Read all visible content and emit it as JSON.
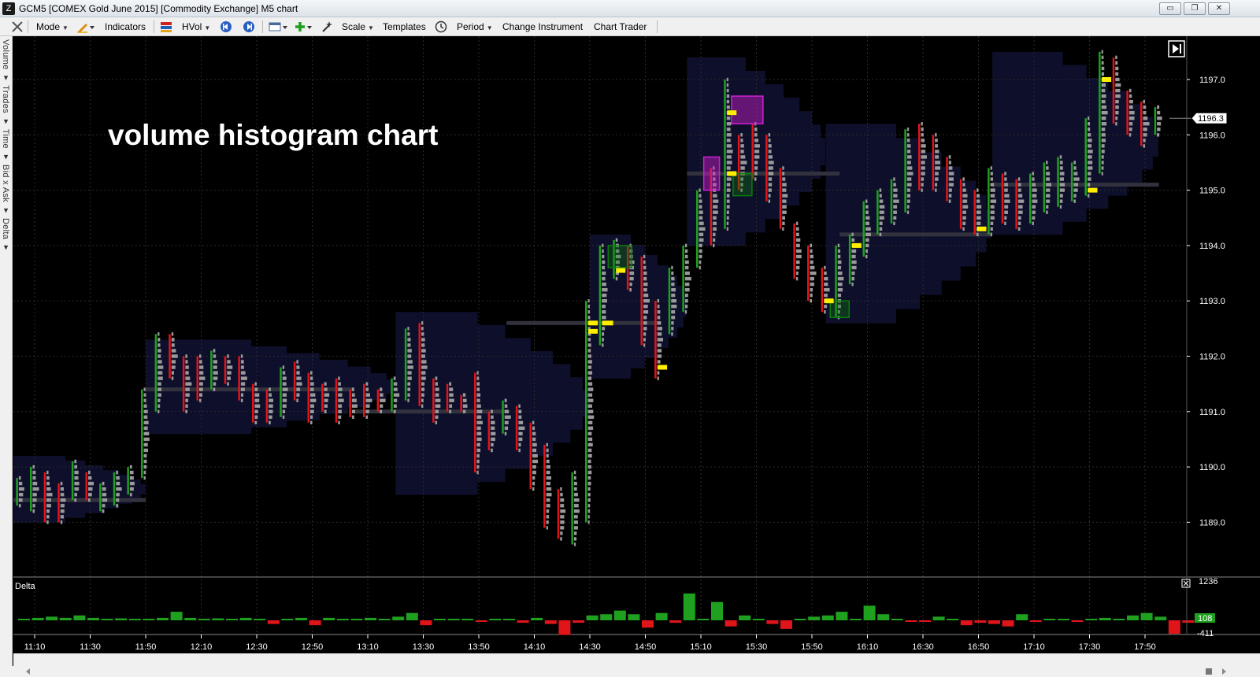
{
  "window": {
    "title": "GCM5 [COMEX Gold June 2015] [Commodity Exchange] M5 chart",
    "logo_letter": "Z",
    "minimize_symbol": "▭",
    "restore_symbol": "❐",
    "close_symbol": "✕"
  },
  "toolbar": {
    "items": [
      {
        "icon": "crosshair-tool-icon",
        "label": "",
        "arrow": false
      },
      {
        "icon": "",
        "label": "Mode",
        "arrow": true
      },
      {
        "icon": "pencil-draw-icon",
        "label": "",
        "arrow": true
      },
      {
        "icon": "",
        "label": "Indicators",
        "arrow": false
      },
      {
        "icon": "color-scheme-icon",
        "label": "",
        "arrow": false
      },
      {
        "icon": "",
        "label": "HVol",
        "arrow": true
      },
      {
        "icon": "rewind-icon",
        "label": "",
        "arrow": false
      },
      {
        "icon": "forward-icon",
        "label": "",
        "arrow": false
      },
      {
        "icon": "chart-window-icon",
        "label": "",
        "arrow": true
      },
      {
        "icon": "add-plus-icon",
        "label": "",
        "arrow": true
      },
      {
        "icon": "magic-wand-icon",
        "label": "",
        "arrow": false
      },
      {
        "icon": "",
        "label": "Scale",
        "arrow": true
      },
      {
        "icon": "",
        "label": "Templates",
        "arrow": false
      },
      {
        "icon": "clock-icon",
        "label": "",
        "arrow": false
      },
      {
        "icon": "",
        "label": "Period",
        "arrow": true
      },
      {
        "icon": "",
        "label": "Change Instrument",
        "arrow": false
      },
      {
        "icon": "",
        "label": "Chart Trader",
        "arrow": false
      }
    ]
  },
  "left_tabs": "Volume ▾ Trades ▾ Time ▾ Bid x Ask ▾ Delta ▾",
  "annotation": "volume histogram chart",
  "chart_data": {
    "type": "bar",
    "instrument": "GCM5",
    "period": "M5",
    "y_ticks": [
      "1197.0",
      "1196.0",
      "1195.0",
      "1194.0",
      "1193.0",
      "1192.0",
      "1191.0",
      "1190.0",
      "1189.0"
    ],
    "ylim": [
      1188.0,
      1197.8
    ],
    "last_price": "1196.3",
    "x_ticks": [
      "11:10",
      "11:30",
      "11:50",
      "12:10",
      "12:30",
      "12:50",
      "13:10",
      "13:30",
      "13:50",
      "14:10",
      "14:30",
      "14:50",
      "15:10",
      "15:30",
      "15:50",
      "16:10",
      "16:30",
      "16:50",
      "17:10",
      "17:30",
      "17:50"
    ],
    "bars": [
      {
        "t": "11:05",
        "low": 1189.3,
        "high": 1189.8,
        "dir": "up"
      },
      {
        "t": "11:10",
        "low": 1189.2,
        "high": 1190.0,
        "dir": "up"
      },
      {
        "t": "11:15",
        "low": 1189.0,
        "high": 1189.9,
        "dir": "down"
      },
      {
        "t": "11:20",
        "low": 1189.0,
        "high": 1189.7,
        "dir": "down"
      },
      {
        "t": "11:25",
        "low": 1189.4,
        "high": 1190.1,
        "dir": "up"
      },
      {
        "t": "11:30",
        "low": 1189.4,
        "high": 1189.9,
        "dir": "down"
      },
      {
        "t": "11:35",
        "low": 1189.2,
        "high": 1189.7,
        "dir": "up"
      },
      {
        "t": "11:40",
        "low": 1189.3,
        "high": 1189.9,
        "dir": "up"
      },
      {
        "t": "11:45",
        "low": 1189.5,
        "high": 1190.0,
        "dir": "up"
      },
      {
        "t": "11:50",
        "low": 1189.8,
        "high": 1191.4,
        "dir": "up"
      },
      {
        "t": "11:55",
        "low": 1191.0,
        "high": 1192.4,
        "dir": "up"
      },
      {
        "t": "12:00",
        "low": 1191.6,
        "high": 1192.4,
        "dir": "down"
      },
      {
        "t": "12:05",
        "low": 1191.0,
        "high": 1192.0,
        "dir": "down"
      },
      {
        "t": "12:10",
        "low": 1191.2,
        "high": 1192.0,
        "dir": "down"
      },
      {
        "t": "12:15",
        "low": 1191.4,
        "high": 1192.1,
        "dir": "up"
      },
      {
        "t": "12:20",
        "low": 1191.5,
        "high": 1192.0,
        "dir": "down"
      },
      {
        "t": "12:25",
        "low": 1191.2,
        "high": 1192.0,
        "dir": "down"
      },
      {
        "t": "12:30",
        "low": 1190.8,
        "high": 1191.5,
        "dir": "down"
      },
      {
        "t": "12:35",
        "low": 1190.8,
        "high": 1191.4,
        "dir": "down"
      },
      {
        "t": "12:40",
        "low": 1190.9,
        "high": 1191.8,
        "dir": "up"
      },
      {
        "t": "12:45",
        "low": 1191.2,
        "high": 1191.9,
        "dir": "down"
      },
      {
        "t": "12:50",
        "low": 1190.8,
        "high": 1191.7,
        "dir": "down"
      },
      {
        "t": "12:55",
        "low": 1191.0,
        "high": 1191.5,
        "dir": "down"
      },
      {
        "t": "13:00",
        "low": 1190.8,
        "high": 1191.6,
        "dir": "down"
      },
      {
        "t": "13:05",
        "low": 1190.9,
        "high": 1191.4,
        "dir": "down"
      },
      {
        "t": "13:10",
        "low": 1190.9,
        "high": 1191.5,
        "dir": "down"
      },
      {
        "t": "13:15",
        "low": 1191.0,
        "high": 1191.4,
        "dir": "down"
      },
      {
        "t": "13:20",
        "low": 1191.0,
        "high": 1191.6,
        "dir": "up"
      },
      {
        "t": "13:25",
        "low": 1191.2,
        "high": 1192.5,
        "dir": "up"
      },
      {
        "t": "13:30",
        "low": 1191.1,
        "high": 1192.6,
        "dir": "down"
      },
      {
        "t": "13:35",
        "low": 1190.8,
        "high": 1191.6,
        "dir": "down"
      },
      {
        "t": "13:40",
        "low": 1191.0,
        "high": 1191.5,
        "dir": "down"
      },
      {
        "t": "13:45",
        "low": 1191.0,
        "high": 1191.3,
        "dir": "down"
      },
      {
        "t": "13:50",
        "low": 1189.9,
        "high": 1191.7,
        "dir": "down"
      },
      {
        "t": "13:55",
        "low": 1190.3,
        "high": 1191.0,
        "dir": "down"
      },
      {
        "t": "14:00",
        "low": 1190.6,
        "high": 1191.2,
        "dir": "up"
      },
      {
        "t": "14:05",
        "low": 1190.3,
        "high": 1191.1,
        "dir": "down"
      },
      {
        "t": "14:10",
        "low": 1189.6,
        "high": 1190.8,
        "dir": "down"
      },
      {
        "t": "14:15",
        "low": 1188.9,
        "high": 1190.4,
        "dir": "down"
      },
      {
        "t": "14:20",
        "low": 1188.7,
        "high": 1189.6,
        "dir": "down"
      },
      {
        "t": "14:25",
        "low": 1188.6,
        "high": 1189.9,
        "dir": "up"
      },
      {
        "t": "14:30",
        "low": 1189.0,
        "high": 1193.0,
        "dir": "up"
      },
      {
        "t": "14:35",
        "low": 1192.2,
        "high": 1194.0,
        "dir": "up"
      },
      {
        "t": "14:40",
        "low": 1193.4,
        "high": 1194.1,
        "dir": "up"
      },
      {
        "t": "14:45",
        "low": 1193.2,
        "high": 1194.0,
        "dir": "down"
      },
      {
        "t": "14:50",
        "low": 1192.2,
        "high": 1193.8,
        "dir": "down"
      },
      {
        "t": "14:55",
        "low": 1191.6,
        "high": 1193.0,
        "dir": "down"
      },
      {
        "t": "15:00",
        "low": 1192.4,
        "high": 1193.6,
        "dir": "up"
      },
      {
        "t": "15:05",
        "low": 1192.8,
        "high": 1194.0,
        "dir": "up"
      },
      {
        "t": "15:10",
        "low": 1193.6,
        "high": 1195.0,
        "dir": "up"
      },
      {
        "t": "15:15",
        "low": 1194.0,
        "high": 1195.4,
        "dir": "down"
      },
      {
        "t": "15:20",
        "low": 1194.3,
        "high": 1197.0,
        "dir": "up"
      },
      {
        "t": "15:25",
        "low": 1195.0,
        "high": 1196.0,
        "dir": "down"
      },
      {
        "t": "15:30",
        "low": 1195.2,
        "high": 1196.2,
        "dir": "down"
      },
      {
        "t": "15:35",
        "low": 1194.8,
        "high": 1196.0,
        "dir": "down"
      },
      {
        "t": "15:40",
        "low": 1194.3,
        "high": 1195.4,
        "dir": "down"
      },
      {
        "t": "15:45",
        "low": 1193.4,
        "high": 1194.4,
        "dir": "down"
      },
      {
        "t": "15:50",
        "low": 1193.0,
        "high": 1194.0,
        "dir": "down"
      },
      {
        "t": "15:55",
        "low": 1192.8,
        "high": 1193.6,
        "dir": "down"
      },
      {
        "t": "16:00",
        "low": 1192.7,
        "high": 1194.0,
        "dir": "up"
      },
      {
        "t": "16:05",
        "low": 1193.3,
        "high": 1194.2,
        "dir": "up"
      },
      {
        "t": "16:10",
        "low": 1193.8,
        "high": 1194.8,
        "dir": "up"
      },
      {
        "t": "16:15",
        "low": 1194.2,
        "high": 1195.0,
        "dir": "up"
      },
      {
        "t": "16:20",
        "low": 1194.4,
        "high": 1195.2,
        "dir": "up"
      },
      {
        "t": "16:25",
        "low": 1194.6,
        "high": 1196.1,
        "dir": "up"
      },
      {
        "t": "16:30",
        "low": 1195.0,
        "high": 1196.2,
        "dir": "down"
      },
      {
        "t": "16:35",
        "low": 1195.0,
        "high": 1196.0,
        "dir": "down"
      },
      {
        "t": "16:40",
        "low": 1194.8,
        "high": 1195.6,
        "dir": "down"
      },
      {
        "t": "16:45",
        "low": 1194.3,
        "high": 1195.2,
        "dir": "down"
      },
      {
        "t": "16:50",
        "low": 1194.2,
        "high": 1195.0,
        "dir": "down"
      },
      {
        "t": "16:55",
        "low": 1194.2,
        "high": 1195.4,
        "dir": "up"
      },
      {
        "t": "17:00",
        "low": 1194.4,
        "high": 1195.3,
        "dir": "down"
      },
      {
        "t": "17:05",
        "low": 1194.3,
        "high": 1195.2,
        "dir": "down"
      },
      {
        "t": "17:10",
        "low": 1194.4,
        "high": 1195.3,
        "dir": "up"
      },
      {
        "t": "17:15",
        "low": 1194.6,
        "high": 1195.5,
        "dir": "up"
      },
      {
        "t": "17:20",
        "low": 1194.7,
        "high": 1195.6,
        "dir": "up"
      },
      {
        "t": "17:25",
        "low": 1194.8,
        "high": 1195.5,
        "dir": "up"
      },
      {
        "t": "17:30",
        "low": 1194.9,
        "high": 1196.3,
        "dir": "up"
      },
      {
        "t": "17:35",
        "low": 1195.3,
        "high": 1197.5,
        "dir": "up"
      },
      {
        "t": "17:40",
        "low": 1196.2,
        "high": 1197.4,
        "dir": "down"
      },
      {
        "t": "17:45",
        "low": 1196.0,
        "high": 1196.8,
        "dir": "down"
      },
      {
        "t": "17:50",
        "low": 1195.8,
        "high": 1196.6,
        "dir": "down"
      },
      {
        "t": "17:55",
        "low": 1196.0,
        "high": 1196.5,
        "dir": "up"
      }
    ],
    "delta_panel": {
      "label": "Delta",
      "top_value": "1236",
      "bottom_value": "-411",
      "last_value": "108",
      "values": [
        5,
        10,
        15,
        10,
        20,
        10,
        5,
        8,
        5,
        5,
        10,
        35,
        10,
        5,
        8,
        5,
        10,
        5,
        -15,
        5,
        10,
        -20,
        10,
        5,
        5,
        10,
        5,
        15,
        30,
        -20,
        5,
        5,
        5,
        -5,
        5,
        5,
        -10,
        10,
        -15,
        -60,
        -10,
        20,
        25,
        40,
        25,
        -30,
        30,
        -10,
        110,
        5,
        75,
        -25,
        20,
        5,
        -15,
        -35,
        5,
        15,
        20,
        35,
        5,
        60,
        25,
        5,
        -5,
        -5,
        15,
        5,
        -20,
        -10,
        -15,
        -25,
        25,
        -5,
        5,
        5,
        -5,
        5,
        10,
        5,
        20,
        30,
        15,
        -55,
        -10,
        20
      ]
    },
    "annotated_levels": {
      "yellow_markers": [
        1192.6,
        1192.45,
        1193.55,
        1191.8,
        1195.3,
        1196.4,
        1193.0,
        1194.0,
        1195.0,
        1194.3,
        1197.0
      ],
      "magenta_boxes": [
        {
          "t": "15:15",
          "lo": 1195.0,
          "hi": 1195.6
        },
        {
          "t": "15:25",
          "lo": 1196.2,
          "hi": 1196.7
        }
      ],
      "green_boxes": [
        {
          "t": "14:40",
          "lo": 1193.6,
          "hi": 1194.0
        },
        {
          "t": "15:25",
          "lo": 1194.9,
          "hi": 1195.3
        },
        {
          "t": "16:00",
          "lo": 1192.7,
          "hi": 1193.0
        }
      ]
    }
  },
  "colors": {
    "background": "#000000",
    "up": "#1fa01f",
    "down": "#e0151a",
    "volume_cell": "#9a9a9a",
    "poc_line": "#32323e",
    "profile": "#0e0f2a",
    "marker": "#ffee00",
    "magenta": "#d020d0",
    "green_box": "#0b7d0b"
  }
}
